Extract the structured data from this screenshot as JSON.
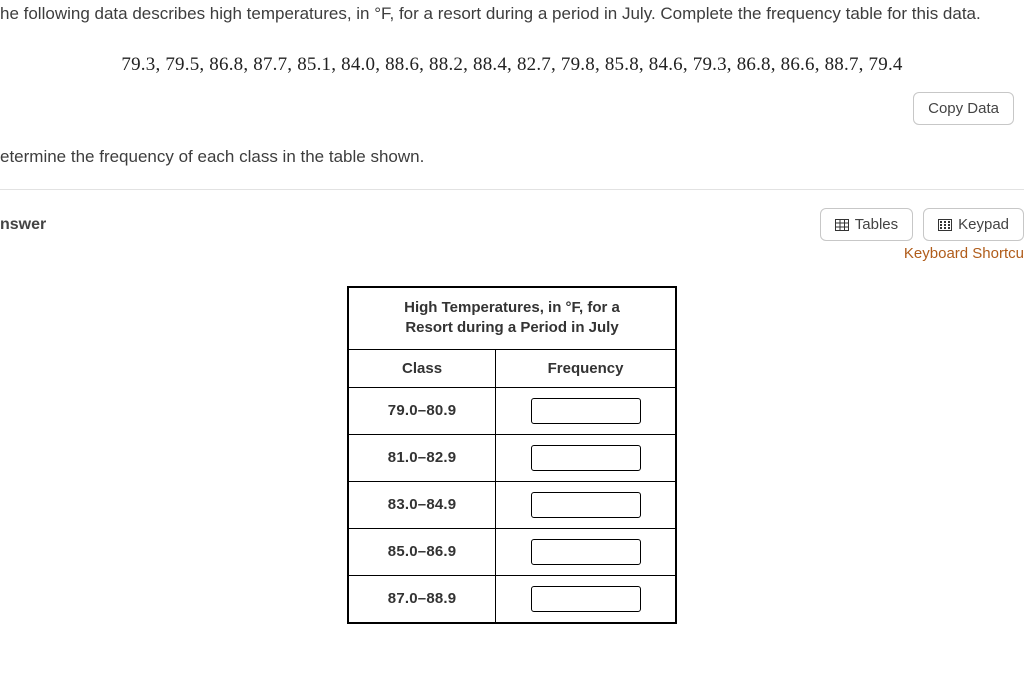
{
  "question": {
    "intro": "he following data describes high temperatures, in °F, for a resort during a period in July. Complete the frequency table for this data.",
    "data_values": "79.3, 79.5, 86.8, 87.7, 85.1, 84.0, 88.6, 88.2, 88.4, 82.7, 79.8, 85.8, 84.6, 79.3, 86.8, 86.6, 88.7, 79.4",
    "instruction": "etermine the frequency of each class in the table shown."
  },
  "buttons": {
    "copy_data": "Copy Data",
    "tables": "Tables",
    "keypad": "Keypad"
  },
  "answer_label": "nswer",
  "shortcut_label": "Keyboard Shortcu",
  "freq_table": {
    "title_line1": "High Temperatures, in °F, for a",
    "title_line2": "Resort during a Period in July",
    "col_class": "Class",
    "col_freq": "Frequency",
    "rows": [
      {
        "class": "79.0–80.9",
        "value": ""
      },
      {
        "class": "81.0–82.9",
        "value": ""
      },
      {
        "class": "83.0–84.9",
        "value": ""
      },
      {
        "class": "85.0–86.9",
        "value": ""
      },
      {
        "class": "87.0–88.9",
        "value": ""
      }
    ]
  }
}
